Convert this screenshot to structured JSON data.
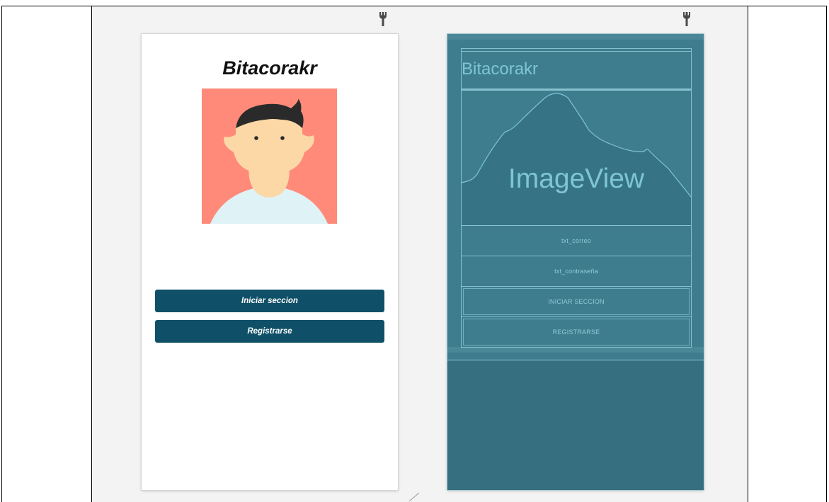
{
  "design_preview": {
    "app_title": "Bitacorakr",
    "buttons": {
      "login_label": "Iniciar seccion",
      "register_label": "Registrarse"
    },
    "button_color": "#0f5068",
    "avatar": {
      "background_color": "#ff8a7a",
      "skin_color": "#fcd8a6",
      "hair_color": "#2a2a2a",
      "shirt_color": "#dff3f7"
    }
  },
  "blueprint": {
    "title": "Bitacorakr",
    "image_label": "ImageView",
    "email_label": "txt_correo",
    "password_label": "txt_contraseña",
    "login_label": "INICIAR SECCION",
    "register_label": "REGISTRARSE"
  },
  "icons": {
    "toolbar": "wrench-icon",
    "resize": "resize-handle-icon"
  }
}
